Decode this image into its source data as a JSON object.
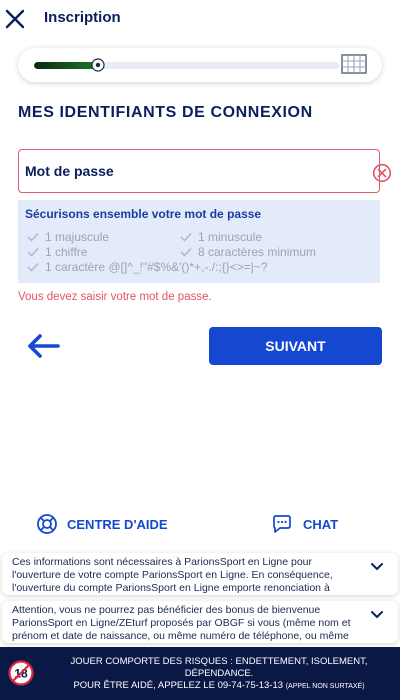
{
  "header": {
    "title": "Inscription"
  },
  "progress": {
    "fraction": 0.22
  },
  "section_title": "Mes identifiants de connexion",
  "password_field": {
    "placeholder": "Mot de passe",
    "value": ""
  },
  "rules": {
    "title": "Sécurisons ensemble votre mot de passe",
    "items": [
      "1 majuscule",
      "1 minuscule",
      "1 chiffre",
      "8 caractères minimum",
      "1 caractère @[]^_!\"#$%&'()*+,-./:;{}<>=|~?"
    ]
  },
  "error_message": "Vous devez saisir votre mot de passe.",
  "next_button": "Suivant",
  "help": {
    "help_label": "Centre d'aide",
    "chat_label": "Chat"
  },
  "info_cards": [
    "Ces informations sont nécessaires à ParionsSport en Ligne pour l'ouverture de votre compte ParionsSport en Ligne. En conséquence, l'ouverture du compte ParionsSport en Ligne emporte renonciation à",
    "Attention, vous ne pourrez pas bénéficier des bonus de bienvenue ParionsSport en Ligne/ZEturf proposés par OBGF si vous (même nom et prénom et date de naissance, ou même numéro de téléphone, ou même"
  ],
  "footer": {
    "badge": "18",
    "line1": "Jouer comporte des risques : endettement, isolement, dépendance.",
    "line2": "Pour être aidé, appelez le 09-74-75-13-13",
    "line2_small": "(appel non surtaxé)"
  },
  "colors": {
    "navy": "#0a1f5c",
    "primary": "#1448d1",
    "error": "#e0566b",
    "rules_bg": "#e3ebfa",
    "footer_bg": "#0a1846"
  }
}
